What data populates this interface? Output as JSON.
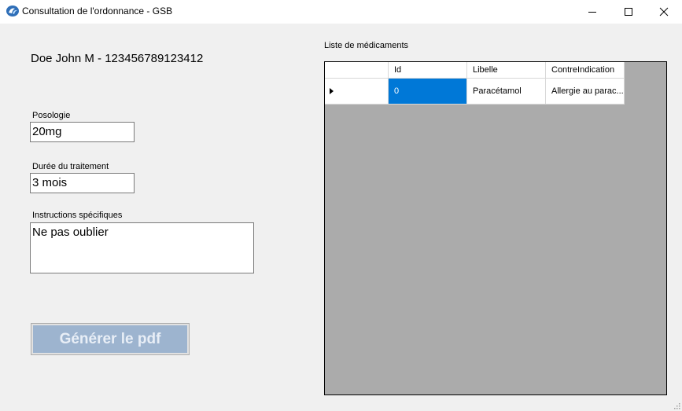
{
  "window": {
    "title": "Consultation de l'ordonnance - GSB",
    "app_icon": "gsb-logo-icon",
    "controls": [
      "minimize-icon",
      "maximize-icon",
      "close-icon"
    ]
  },
  "patient": {
    "label": "Doe John M - 123456789123412"
  },
  "form": {
    "posologie_label": "Posologie",
    "posologie_value": "20mg",
    "duree_label": "Durée du traitement",
    "duree_value": "3 mois",
    "instructions_label": "Instructions spécifiques",
    "instructions_value": "Ne pas oublier"
  },
  "actions": {
    "generate_label": "Générer le pdf",
    "generate_color": "#9db4cf"
  },
  "medications": {
    "title": "Liste de médicaments",
    "columns": [
      "Id",
      "Libelle",
      "ContreIndication"
    ],
    "rows": [
      {
        "id": "0",
        "libelle": "Paracétamol",
        "contre_indication": "Allergie au parac..."
      }
    ],
    "selection_color": "#0078d7",
    "background_color": "#ababab"
  }
}
